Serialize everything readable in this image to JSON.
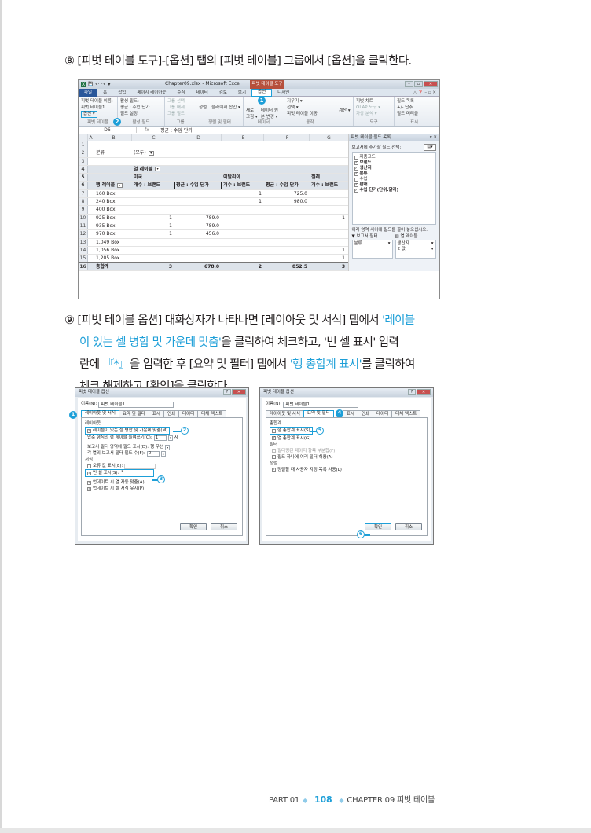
{
  "step8": {
    "number": "⑧",
    "text": "[피벗 테이블 도구]-[옵션] 탭의 [피벗 테이블] 그룹에서 [옵션]을 클릭한다."
  },
  "excel": {
    "quick_access": [
      "X",
      "💾",
      "↶",
      "↷",
      "▾"
    ],
    "window_title": "Chapter09.xlsx - Microsoft Excel",
    "context_tab": "피벗 테이블 도구",
    "window_controls": [
      "–",
      "▫",
      "✕"
    ],
    "tabs": [
      "파일",
      "홈",
      "삽입",
      "페이지 레이아웃",
      "수식",
      "데이터",
      "검토",
      "보기",
      "옵션",
      "디자인"
    ],
    "active_tab": "옵션",
    "ribbon": {
      "pivot_table": {
        "name_label": "피벗 테이블 이름:",
        "name_value": "피벗 테이블1",
        "options_button": "옵션 ▾",
        "group_label": "피벗 테이블"
      },
      "active_field": {
        "label": "활성 필드:",
        "value": "평균 : 수입 단가",
        "settings": "필드 설정",
        "group_label": "활성 필드"
      },
      "group": {
        "items": [
          "그룹 선택",
          "그룹 해제",
          "그룹 필드"
        ],
        "group_label": "그룹"
      },
      "sort_filter": {
        "items": [
          "정렬",
          "슬라이서 삽입 ▾"
        ],
        "group_label": "정렬 및 필터"
      },
      "data": {
        "items": [
          "새로 고침 ▾",
          "데이터 원본 변경 ▾"
        ],
        "group_label": "데이터"
      },
      "actions": {
        "items": [
          "지우기 ▾",
          "선택 ▾",
          "피벗 테이블 이동"
        ],
        "group_label": "동작"
      },
      "calc": {
        "label": "계산 ▾"
      },
      "tools": {
        "items": [
          "피벗 차트",
          "OLAP 도구 ▾",
          "가상 분석 ▾"
        ],
        "group_label": "도구"
      },
      "show": {
        "items": [
          "필드 목록",
          "+/- 단추",
          "필드 머리글"
        ],
        "group_label": "표시"
      }
    },
    "formula_bar": {
      "name_box": "D6",
      "fx": "fx",
      "value": "평균 : 수입 단가"
    },
    "columns": [
      "A",
      "B",
      "C",
      "D",
      "E",
      "F",
      "G"
    ],
    "rows": [
      {
        "n": "1",
        "B": "",
        "C": "",
        "D": "",
        "E": "",
        "F": "",
        "G": ""
      },
      {
        "n": "2",
        "B": "분류",
        "C": "(모두)",
        "D": "",
        "E": "",
        "F": "",
        "G": ""
      },
      {
        "n": "3",
        "B": "",
        "C": "",
        "D": "",
        "E": "",
        "F": "",
        "G": ""
      },
      {
        "n": "4",
        "B": "",
        "C": "열 레이블",
        "D": "",
        "E": "",
        "F": "",
        "G": ""
      },
      {
        "n": "5",
        "B": "",
        "C": "미국",
        "D": "",
        "E": "이탈리아",
        "F": "",
        "G": "칠레"
      },
      {
        "n": "6",
        "B": "행 레이블",
        "C": "개수 : 브랜드",
        "D": "평균 : 수입 단가",
        "E": "개수 : 브랜드",
        "F": "평균 : 수입 단가",
        "G": "개수 : 브랜드"
      },
      {
        "n": "7",
        "B": "160 Box",
        "C": "",
        "D": "",
        "E": "1",
        "F": "725.0",
        "G": ""
      },
      {
        "n": "8",
        "B": "240 Box",
        "C": "",
        "D": "",
        "E": "1",
        "F": "980.0",
        "G": ""
      },
      {
        "n": "9",
        "B": "400 Box",
        "C": "",
        "D": "",
        "E": "",
        "F": "",
        "G": ""
      },
      {
        "n": "10",
        "B": "925 Box",
        "C": "1",
        "D": "789.0",
        "E": "",
        "F": "",
        "G": "1"
      },
      {
        "n": "11",
        "B": "935 Box",
        "C": "1",
        "D": "789.0",
        "E": "",
        "F": "",
        "G": ""
      },
      {
        "n": "12",
        "B": "970 Box",
        "C": "1",
        "D": "456.0",
        "E": "",
        "F": "",
        "G": ""
      },
      {
        "n": "13",
        "B": "1,049 Box",
        "C": "",
        "D": "",
        "E": "",
        "F": "",
        "G": ""
      },
      {
        "n": "14",
        "B": "1,056 Box",
        "C": "",
        "D": "",
        "E": "",
        "F": "",
        "G": "1"
      },
      {
        "n": "15",
        "B": "1,205 Box",
        "C": "",
        "D": "",
        "E": "",
        "F": "",
        "G": "1"
      },
      {
        "n": "16",
        "B": "총합계",
        "C": "3",
        "D": "678.0",
        "E": "2",
        "F": "852.5",
        "G": "3"
      }
    ],
    "field_list": {
      "title": "피벗 테이블 필드 목록",
      "choose_label": "보고서에 추가할 필드 선택:",
      "fields": [
        {
          "label": "제품코드",
          "checked": false
        },
        {
          "label": "브랜드",
          "checked": true
        },
        {
          "label": "생산지",
          "checked": true
        },
        {
          "label": "분류",
          "checked": true
        },
        {
          "label": "수입",
          "checked": false
        },
        {
          "label": "판매",
          "checked": true
        },
        {
          "label": "수입 단가(단위:달러)",
          "checked": true
        }
      ],
      "drag_note": "아래 영역 사이에 필드를 끌어 놓으십시오.",
      "report_filter_label": "보고서 필터",
      "report_filter_items": [
        "분류"
      ],
      "column_labels_label": "열 레이블",
      "column_labels_items": [
        "생산지",
        "Σ 값"
      ]
    }
  },
  "step9": {
    "number": "⑨",
    "line1_a": "[피벗 테이블 옵션] 대화상자가 나타나면 [레이아웃 및 서식] 탭에서 ",
    "line1_hl": "'레이블",
    "line2_hl": "이 있는 셀 병합 및 가운데 맞춤'",
    "line2_b": "을 클릭하여 체크하고, '빈 셀 표시' 입력",
    "line3_a": "란에 ",
    "line3_hl1": "『*』",
    "line3_b": "을 입력한 후 [요약 및 필터] 탭에서 ",
    "line3_hl2": "'행 총합계 표시'",
    "line3_c": "를 클릭하여",
    "line4": "체크 해제하고 [확인]을 클릭한다."
  },
  "dialog_layout": {
    "title": "피벗 테이블 옵션",
    "name_label": "이름(N):",
    "name_value": "피벗 테이블1",
    "tabs": [
      "레이아웃 및 서식",
      "요약 및 필터",
      "표시",
      "인쇄",
      "데이터",
      "대체 텍스트"
    ],
    "active_tab": "레이아웃 및 서식",
    "layout_section": "레이아웃",
    "merge_label": "레이블이 있는 셀 병합 및 가운데 맞춤(M)",
    "merge_checked": true,
    "indent_label": "압축 형식의 행 레이블 들여쓰기(C):",
    "indent_value": "1",
    "indent_unit": "자",
    "filter_area_label": "보고서 필터 영역에 필드 표시(D):",
    "filter_area_value": "행 우선",
    "filter_fields_label": "각 열의 보고서 필터 필드 수(F):",
    "filter_fields_value": "0",
    "format_section": "서식",
    "error_label": "오류 값 표시(E):",
    "error_checked": false,
    "empty_label": "빈 셀 표시(S):",
    "empty_checked": true,
    "empty_value": "*",
    "autofit_label": "업데이트 시 열 자동 맞춤(A)",
    "autofit_checked": true,
    "preserve_label": "업데이트 시 셀 서식 유지(P)",
    "preserve_checked": true,
    "ok": "확인",
    "cancel": "취소",
    "badges": [
      "1",
      "2",
      "3"
    ]
  },
  "dialog_summary": {
    "title": "피벗 테이블 옵션",
    "name_label": "이름(N):",
    "name_value": "피벗 테이블1",
    "tabs": [
      "레이아웃 및 서식",
      "요약 및 필터",
      "표시",
      "인쇄",
      "데이터",
      "대체 텍스트"
    ],
    "active_tab": "요약 및 필터",
    "totals_section": "총합계",
    "row_totals_label": "행 총합계 표시(S)",
    "row_totals_checked": false,
    "col_totals_label": "열 총합계 표시(G)",
    "col_totals_checked": true,
    "filter_section": "필터",
    "subtotal_filtered_label": "필터링된 페이지 항목 부분합(F)",
    "subtotal_filtered_checked": false,
    "multi_filter_label": "필드 하나에 여러 필터 허용(A)",
    "multi_filter_checked": false,
    "sort_section": "정렬",
    "custom_list_label": "정렬할 때 사용자 지정 목록 사용(L)",
    "custom_list_checked": true,
    "ok": "확인",
    "cancel": "취소",
    "badges": [
      "4",
      "5",
      "6"
    ]
  },
  "footer": {
    "part": "PART 01",
    "page": "108",
    "chapter": "CHAPTER 09 피벗 테이블"
  },
  "colors": {
    "accent": "#1d9fd8",
    "context_tab": "#b6503c",
    "file_tab": "#2a579a"
  }
}
